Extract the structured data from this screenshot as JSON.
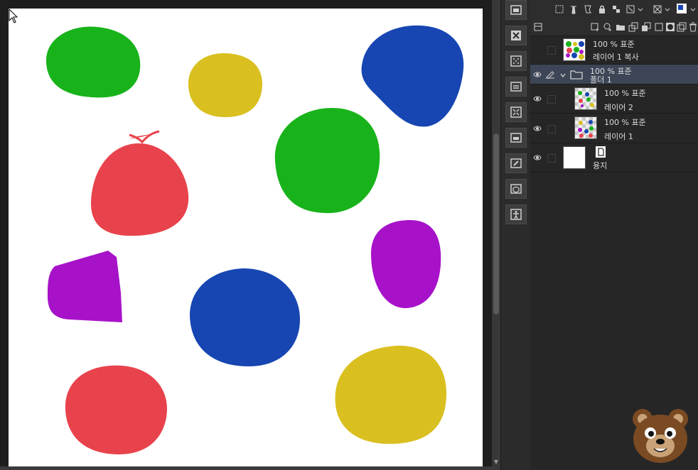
{
  "layers": [
    {
      "opacity_blend": "100 % 표준",
      "name": "레이어 1 복사"
    },
    {
      "opacity_blend": "100 % 표준",
      "name": "폴더 1"
    },
    {
      "opacity_blend": "100 % 표준",
      "name": "레이어 2"
    },
    {
      "opacity_blend": "100 % 표준",
      "name": "레이어 1"
    },
    {
      "name": "용지"
    }
  ],
  "canvas_shapes": [
    {
      "kind": "blob",
      "color": "#18b31a"
    },
    {
      "kind": "blob",
      "color": "#d9c020"
    },
    {
      "kind": "blob",
      "color": "#1746b2"
    },
    {
      "kind": "blob",
      "color": "#e8434d"
    },
    {
      "kind": "blob",
      "color": "#18b31a"
    },
    {
      "kind": "blob",
      "color": "#a712c9"
    },
    {
      "kind": "blob",
      "color": "#a712c9"
    },
    {
      "kind": "blob",
      "color": "#1746b2"
    },
    {
      "kind": "blob",
      "color": "#e8434d"
    },
    {
      "kind": "blob",
      "color": "#d9c020"
    }
  ],
  "colors": {
    "green": "#18b31a",
    "yellow": "#d9c020",
    "blue": "#1746b2",
    "red": "#e8434d",
    "purple": "#a712c9",
    "selection": "#3d4656"
  },
  "icons": {
    "cursor": "arrow-cursor-icon",
    "eye": "eye-icon",
    "folder": "folder-icon",
    "mascot": "bear-mascot-icon"
  }
}
